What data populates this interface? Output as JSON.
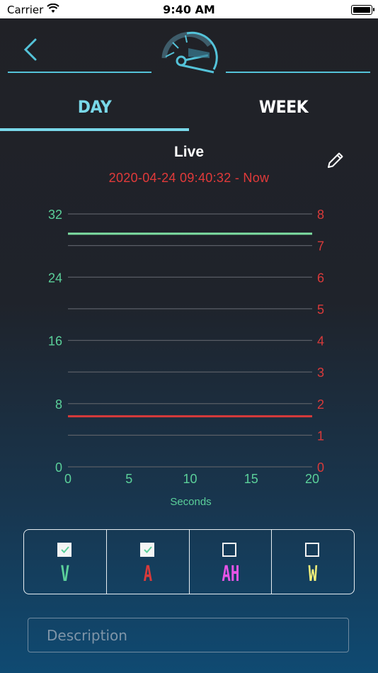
{
  "status_bar": {
    "carrier": "Carrier",
    "time": "9:40 AM"
  },
  "header": {
    "accent_color": "#54c3d9",
    "back_icon": "chevron-left-icon",
    "logo_icon": "speedometer-icon"
  },
  "tabs": [
    {
      "label": "DAY",
      "active": true
    },
    {
      "label": "WEEK",
      "active": false
    }
  ],
  "live": {
    "title": "Live",
    "range_text": "2020-04-24 09:40:32 - Now",
    "range_color": "#e23a3a",
    "edit_icon": "pencil-icon"
  },
  "chart_data": {
    "type": "line",
    "xlabel": "Seconds",
    "x_ticks": [
      0,
      5,
      10,
      15,
      20
    ],
    "xlim": [
      0,
      20
    ],
    "left_axis": {
      "ticks": [
        0,
        8,
        16,
        24,
        32
      ],
      "ylim": [
        0,
        32
      ],
      "color": "#5bd09a"
    },
    "right_axis": {
      "ticks": [
        0,
        1,
        2,
        3,
        4,
        5,
        6,
        7,
        8
      ],
      "ylim": [
        0,
        8
      ],
      "color": "#d93a3a"
    },
    "grid": true,
    "series": [
      {
        "axis": "left",
        "color": "#7ee0a3",
        "x": [
          0,
          20
        ],
        "y": [
          29.5,
          29.5
        ]
      },
      {
        "axis": "right",
        "color": "#d93a3a",
        "x": [
          0,
          20
        ],
        "y": [
          1.6,
          1.6
        ]
      }
    ]
  },
  "measures": [
    {
      "label": "V",
      "checked": true,
      "color": "#5bd09a"
    },
    {
      "label": "A",
      "checked": true,
      "color": "#d93a3a"
    },
    {
      "label": "AH",
      "checked": false,
      "color": "#e654e6"
    },
    {
      "label": "W",
      "checked": false,
      "color": "#f3f07a"
    }
  ],
  "description": {
    "placeholder": "Description",
    "value": ""
  }
}
